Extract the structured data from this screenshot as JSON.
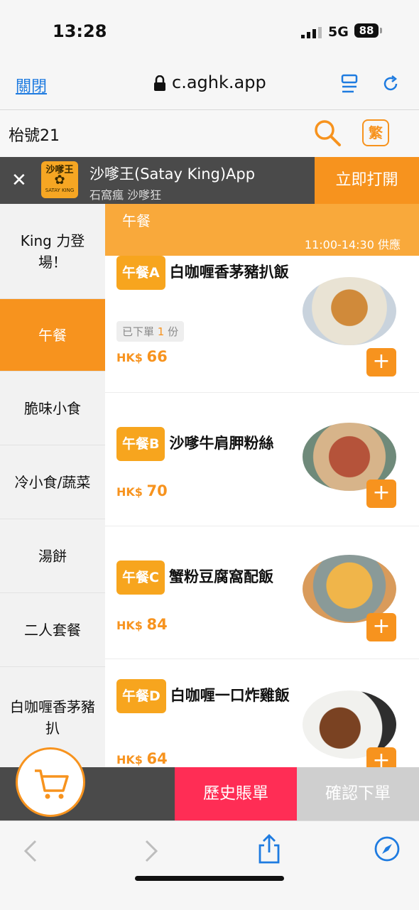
{
  "status": {
    "time": "13:28",
    "network": "5G",
    "battery": "88"
  },
  "browser": {
    "close_label": "關閉",
    "url": "c.aghk.app"
  },
  "store": {
    "name": "枱號21",
    "lang_label": "繁"
  },
  "app_banner": {
    "title": "沙嗲王(Satay King)App",
    "subtitle": "石窩瘋 沙嗲狂",
    "open_label": "立即打開",
    "logo_text": "沙嗲王",
    "logo_sub": "SATAY KING"
  },
  "sidebar": {
    "categories": [
      {
        "label": "King 力登場！"
      },
      {
        "label": "午餐"
      },
      {
        "label": "脆味小食"
      },
      {
        "label": "冷小食/蔬菜"
      },
      {
        "label": "湯餅"
      },
      {
        "label": "二人套餐"
      },
      {
        "label": "白咖喱香茅豬扒"
      }
    ],
    "active": "午餐"
  },
  "section": {
    "title": "午餐",
    "hours": "11:00-14:30 供應"
  },
  "menu_items": [
    {
      "badge": "午餐A",
      "name": "白咖喱香茅豬扒飯",
      "ordered_prefix": "已下單",
      "ordered_count": "1",
      "ordered_suffix": "份",
      "currency": "HK$",
      "price": "66"
    },
    {
      "badge": "午餐B",
      "name": "沙嗲牛肩胛粉絲",
      "currency": "HK$",
      "price": "70"
    },
    {
      "badge": "午餐C",
      "name": "蟹粉豆腐窩配飯",
      "currency": "HK$",
      "price": "84"
    },
    {
      "badge": "午餐D",
      "name": "白咖喱一口炸雞飯",
      "currency": "HK$",
      "price": "64"
    }
  ],
  "actions": {
    "history_label": "歷史賬單",
    "confirm_label": "確認下單"
  },
  "colors": {
    "accent": "#f7931e",
    "history": "#ff2d55",
    "banner": "#4a4a4a"
  }
}
